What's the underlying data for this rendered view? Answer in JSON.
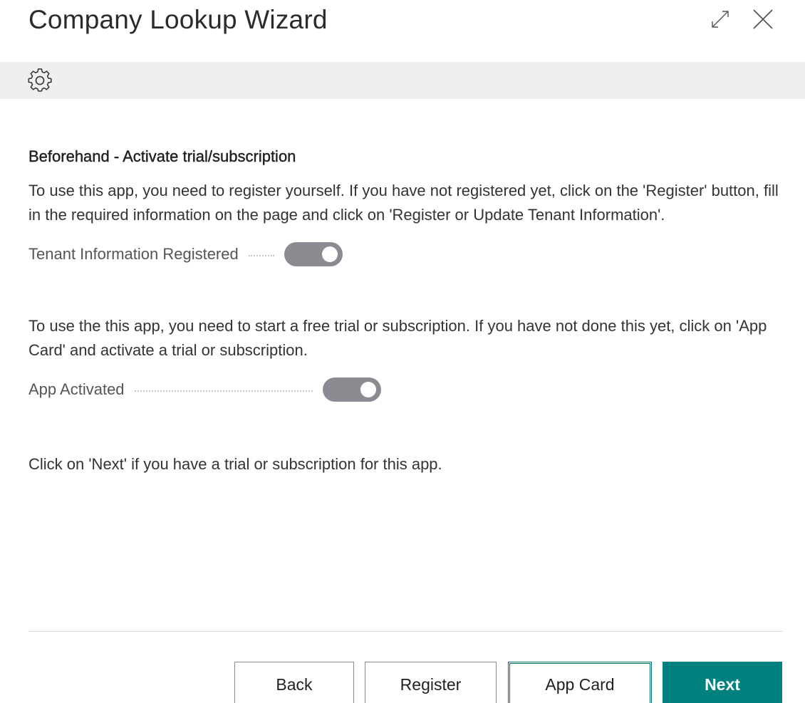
{
  "window": {
    "title": "Company Lookup Wizard",
    "expand_icon": "expand-arrows-icon",
    "close_icon": "close-icon"
  },
  "toolbar": {
    "settings_icon": "gear-icon"
  },
  "content": {
    "heading": "Beforehand - Activate trial/subscription",
    "register_paragraph": "To use this app, you need to register yourself. If you have not registered yet, click on the 'Register' button, fill in the required information on the page and click on 'Register or Update Tenant Information'.",
    "tenant_field": {
      "label": "Tenant Information Registered",
      "value": true
    },
    "trial_paragraph": "To use the this app, you need to start a free trial or subscription. If you have not done this yet, click on 'App Card' and activate a trial or subscription.",
    "activated_field": {
      "label": "App Activated",
      "value": true
    },
    "next_paragraph": "Click on 'Next' if you have a trial or subscription for this app."
  },
  "buttons": {
    "back": "Back",
    "register": "Register",
    "app_card": "App Card",
    "next": "Next"
  },
  "colors": {
    "accent": "#00817f",
    "toggle_disabled": "#8a8c92",
    "toolbar_bg": "#efefef"
  }
}
